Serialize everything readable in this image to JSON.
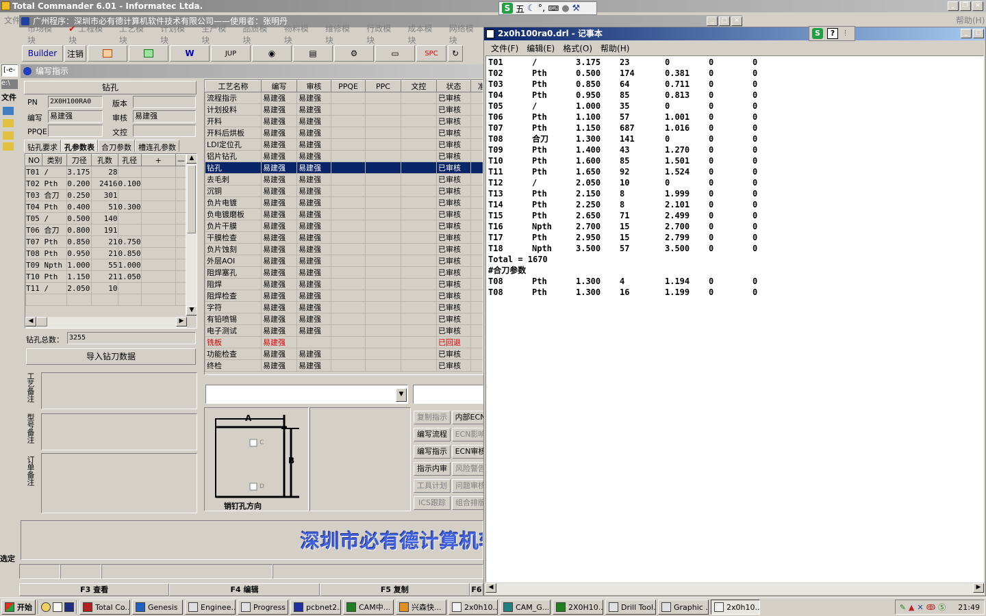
{
  "total_commander": {
    "title": "Total Commander 6.01 - Informatec Ltda.",
    "help": "帮助(H)",
    "left_labels": [
      "文件",
      "选定"
    ]
  },
  "erp": {
    "title": "广州程序：深圳市必有德计算机软件技术有限公司——使用者：张明丹",
    "menu": [
      "市场模块",
      "工程模块",
      "工艺模块",
      "计划模块",
      "生产模块",
      "品质模块",
      "物料模块",
      "维修模块",
      "行政模块",
      "成本模块",
      "网络模块"
    ],
    "toolbar": [
      "Builder",
      "注销",
      "",
      "",
      "W",
      "JUP",
      "",
      "",
      "",
      "",
      "SPC",
      ""
    ],
    "window_title": "编写指示",
    "left": {
      "section_title": "钻孔",
      "pn_label": "PN",
      "pn_value": "2X0H100RA0",
      "version_label": "版本",
      "version_value": "",
      "editor_label": "编写",
      "editor_value": "易建强",
      "review_label": "审核",
      "review_value": "易建强",
      "ppqe_label": "PPQE",
      "ppqe_value": "",
      "doc_label": "文控",
      "doc_value": "",
      "tabs": [
        "钻孔要求",
        "孔参数表",
        "合刀参数",
        "槽连孔参数"
      ],
      "grid_headers": [
        "NO",
        "类别",
        "刀径",
        "孔数",
        "孔径",
        "+",
        "—"
      ],
      "grid_rows": [
        [
          "T01",
          "/",
          "3.175",
          "28",
          ""
        ],
        [
          "T02",
          "Pth",
          "0.200",
          "2416",
          "0.100"
        ],
        [
          "T03",
          "合刀",
          "0.250",
          "301",
          ""
        ],
        [
          "T04",
          "Pth",
          "0.400",
          "51",
          "0.300"
        ],
        [
          "T05",
          "/",
          "0.500",
          "140",
          ""
        ],
        [
          "T06",
          "合刀",
          "0.800",
          "191",
          ""
        ],
        [
          "T07",
          "Pth",
          "0.850",
          "21",
          "0.750"
        ],
        [
          "T08",
          "Pth",
          "0.950",
          "21",
          "0.850"
        ],
        [
          "T09",
          "Npth",
          "1.000",
          "55",
          "1.000"
        ],
        [
          "T10",
          "Pth",
          "1.150",
          "21",
          "1.050"
        ],
        [
          "T11",
          "/",
          "2.050",
          "10",
          ""
        ]
      ],
      "total_label": "钻孔总数：",
      "total_value": "3255",
      "import_button": "导入钻刀数据",
      "notes": [
        "工艺备注",
        "型号备注",
        "订单备注"
      ]
    },
    "process": {
      "headers": [
        "工艺名称",
        "编写",
        "审核",
        "PPQE",
        "PPC",
        "文控",
        "状态",
        "准"
      ],
      "rows": [
        [
          "流程指示",
          "易建强",
          "易建强",
          "",
          "",
          "",
          "已审核"
        ],
        [
          "计划投料",
          "易建强",
          "易建强",
          "",
          "",
          "",
          "已审核"
        ],
        [
          "开料",
          "易建强",
          "易建强",
          "",
          "",
          "",
          "已审核"
        ],
        [
          "开料后烘板",
          "易建强",
          "易建强",
          "",
          "",
          "",
          "已审核"
        ],
        [
          "LDI定位孔",
          "易建强",
          "易建强",
          "",
          "",
          "",
          "已审核"
        ],
        [
          "铝片钻孔",
          "易建强",
          "易建强",
          "",
          "",
          "",
          "已审核"
        ],
        [
          "钻孔",
          "易建强",
          "易建强",
          "",
          "",
          "",
          "已审核"
        ],
        [
          "去毛刺",
          "易建强",
          "易建强",
          "",
          "",
          "",
          "已审核"
        ],
        [
          "沉铜",
          "易建强",
          "易建强",
          "",
          "",
          "",
          "已审核"
        ],
        [
          "负片电镀",
          "易建强",
          "易建强",
          "",
          "",
          "",
          "已审核"
        ],
        [
          "负电镀磨板",
          "易建强",
          "易建强",
          "",
          "",
          "",
          "已审核"
        ],
        [
          "负片干膜",
          "易建强",
          "易建强",
          "",
          "",
          "",
          "已审核"
        ],
        [
          "干膜检查",
          "易建强",
          "易建强",
          "",
          "",
          "",
          "已审核"
        ],
        [
          "负片蚀刻",
          "易建强",
          "易建强",
          "",
          "",
          "",
          "已审核"
        ],
        [
          "外层AOI",
          "易建强",
          "易建强",
          "",
          "",
          "",
          "已审核"
        ],
        [
          "阻焊塞孔",
          "易建强",
          "易建强",
          "",
          "",
          "",
          "已审核"
        ],
        [
          "阻焊",
          "易建强",
          "易建强",
          "",
          "",
          "",
          "已审核"
        ],
        [
          "阻焊检查",
          "易建强",
          "易建强",
          "",
          "",
          "",
          "已审核"
        ],
        [
          "字符",
          "易建强",
          "易建强",
          "",
          "",
          "",
          "已审核"
        ],
        [
          "有铅喷锡",
          "易建强",
          "易建强",
          "",
          "",
          "",
          "已审核"
        ],
        [
          "电子测试",
          "易建强",
          "易建强",
          "",
          "",
          "",
          "已审核"
        ],
        [
          "铣板",
          "易建强",
          "",
          "",
          "",
          "",
          "已回退"
        ],
        [
          "功能检查",
          "易建强",
          "易建强",
          "",
          "",
          "",
          "已审核"
        ],
        [
          "终检",
          "易建强",
          "易建强",
          "",
          "",
          "",
          "已审核"
        ]
      ],
      "selected_index": 6,
      "returned_index": 21
    },
    "diagram": {
      "a": "A",
      "b": "B",
      "c": "C",
      "d": "D",
      "caption": "销钉孔方向"
    },
    "buttons_col1": [
      "复制指示",
      "编写流程",
      "编写指示",
      "指示内审",
      "工具计划",
      "ICS跟踪"
    ],
    "buttons_col2": [
      "内部ECN",
      "ECN影响",
      "ECN审核",
      "风险警告",
      "问题审核",
      "组合排版"
    ],
    "banner": "深圳市必有德计算机软",
    "fkeys": [
      "F3 查看",
      "F4 编辑",
      "F5 复制",
      "F6"
    ]
  },
  "notepad": {
    "title": "2x0h100ra0.drl - 记事本",
    "menu": [
      "文件(F)",
      "编辑(E)",
      "格式(O)",
      "帮助(H)"
    ],
    "lines": [
      [
        "T01",
        "/",
        "3.175",
        "23",
        "0",
        "0",
        "0"
      ],
      [
        "T02",
        "Pth",
        "0.500",
        "174",
        "0.381",
        "0",
        "0"
      ],
      [
        "T03",
        "Pth",
        "0.850",
        "64",
        "0.711",
        "0",
        "0"
      ],
      [
        "T04",
        "Pth",
        "0.950",
        "85",
        "0.813",
        "0",
        "0"
      ],
      [
        "T05",
        "/",
        "1.000",
        "35",
        "0",
        "0",
        "0"
      ],
      [
        "T06",
        "Pth",
        "1.100",
        "57",
        "1.001",
        "0",
        "0"
      ],
      [
        "T07",
        "Pth",
        "1.150",
        "687",
        "1.016",
        "0",
        "0"
      ],
      [
        "T08",
        "合刀",
        "1.300",
        "141",
        "0",
        "0",
        "0"
      ],
      [
        "T09",
        "Pth",
        "1.400",
        "43",
        "1.270",
        "0",
        "0"
      ],
      [
        "T10",
        "Pth",
        "1.600",
        "85",
        "1.501",
        "0",
        "0"
      ],
      [
        "T11",
        "Pth",
        "1.650",
        "92",
        "1.524",
        "0",
        "0"
      ],
      [
        "T12",
        "/",
        "2.050",
        "10",
        "0",
        "0",
        "0"
      ],
      [
        "T13",
        "Pth",
        "2.150",
        "8",
        "1.999",
        "0",
        "0"
      ],
      [
        "T14",
        "Pth",
        "2.250",
        "8",
        "2.101",
        "0",
        "0"
      ],
      [
        "T15",
        "Pth",
        "2.650",
        "71",
        "2.499",
        "0",
        "0"
      ],
      [
        "T16",
        "Npth",
        "2.700",
        "15",
        "2.700",
        "0",
        "0"
      ],
      [
        "T17",
        "Pth",
        "2.950",
        "15",
        "2.799",
        "0",
        "0"
      ],
      [
        "T18",
        "Npth",
        "3.500",
        "57",
        "3.500",
        "0",
        "0"
      ]
    ],
    "total_line": "Total = 1670",
    "section_line": "#合刀参数",
    "extra_lines": [
      [
        "T08",
        "Pth",
        "1.300",
        "4",
        "1.194",
        "0",
        "0"
      ],
      [
        "T08",
        "Pth",
        "1.300",
        "16",
        "1.199",
        "0",
        "0"
      ]
    ]
  },
  "taskbar": {
    "start": "开始",
    "items": [
      "Total Co...",
      "Genesis",
      "Enginee...",
      "Progress",
      "pcbnet2...",
      "CAM中...",
      "兴森快...",
      "2x0h10...",
      "CAM_G...",
      "2X0H10...",
      "Drill Tool...",
      "Graphic ...",
      "2x0h10..."
    ],
    "active_index": 12,
    "clock": "21:49"
  },
  "ime": {
    "label": "五"
  }
}
